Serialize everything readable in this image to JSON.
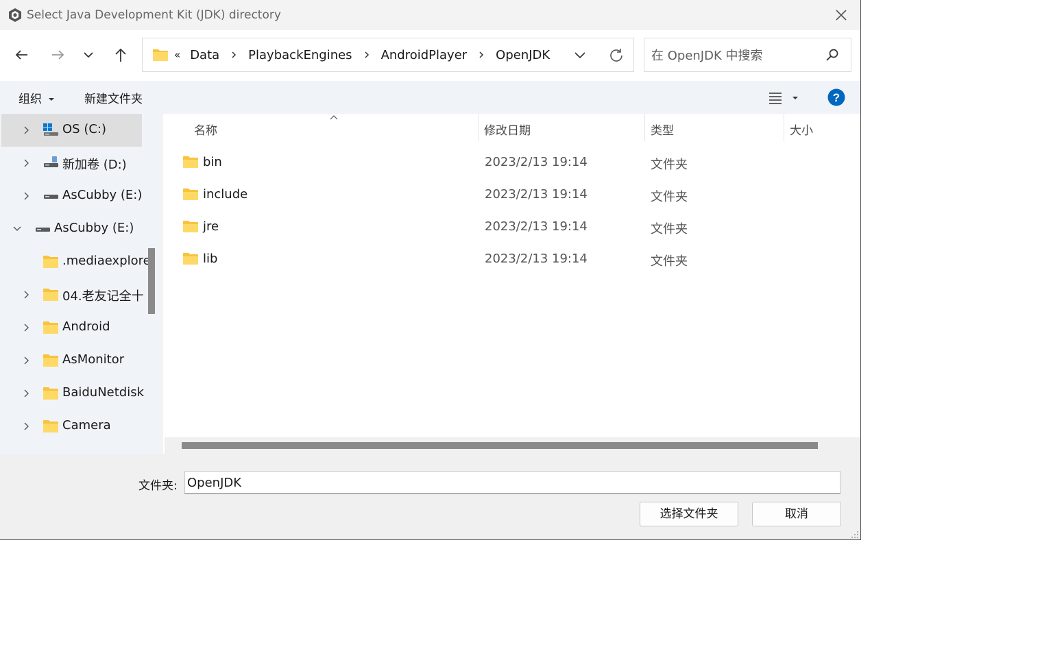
{
  "window": {
    "title": "Select Java Development Kit (JDK) directory"
  },
  "address": {
    "overflow": "«",
    "crumbs": [
      "Data",
      "PlaybackEngines",
      "AndroidPlayer",
      "OpenJDK"
    ]
  },
  "search": {
    "placeholder": "在 OpenJDK 中搜索"
  },
  "toolbar": {
    "organize": "组织",
    "new_folder": "新建文件夹"
  },
  "nav": {
    "items": [
      {
        "label": "OS (C:)",
        "icon": "windows-drive-icon"
      },
      {
        "label": "新加卷 (D:)",
        "icon": "drive-icon"
      },
      {
        "label": "AsCubby (E:)",
        "icon": "drive-icon"
      },
      {
        "label": "AsCubby (E:)",
        "icon": "drive-icon"
      },
      {
        "label": ".mediaexplore",
        "icon": "folder-icon"
      },
      {
        "label": "04.老友记全十",
        "icon": "folder-icon"
      },
      {
        "label": "Android",
        "icon": "folder-icon"
      },
      {
        "label": "AsMonitor",
        "icon": "folder-icon"
      },
      {
        "label": "BaiduNetdisk",
        "icon": "folder-icon"
      },
      {
        "label": "Camera",
        "icon": "folder-icon"
      }
    ]
  },
  "columns": {
    "name": "名称",
    "date": "修改日期",
    "type": "类型",
    "size": "大小"
  },
  "files": [
    {
      "name": "bin",
      "date": "2023/2/13 19:14",
      "type": "文件夹"
    },
    {
      "name": "include",
      "date": "2023/2/13 19:14",
      "type": "文件夹"
    },
    {
      "name": "jre",
      "date": "2023/2/13 19:14",
      "type": "文件夹"
    },
    {
      "name": "lib",
      "date": "2023/2/13 19:14",
      "type": "文件夹"
    }
  ],
  "footer": {
    "folder_label": "文件夹:",
    "folder_value": "OpenJDK",
    "select_button": "选择文件夹",
    "cancel_button": "取消"
  },
  "colors": {
    "accent": "#0067c0",
    "folder": "#f8c33d"
  }
}
